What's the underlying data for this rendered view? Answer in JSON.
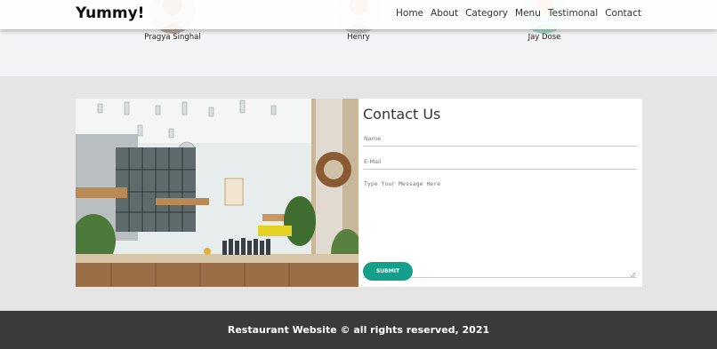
{
  "brand": "Yummy!",
  "nav": [
    "Home",
    "About",
    "Category",
    "Menu",
    "Testimonal",
    "Contact"
  ],
  "testimonials": [
    {
      "name": "Pragya Singhal"
    },
    {
      "name": "Henry"
    },
    {
      "name": "Jay Dose"
    }
  ],
  "contact": {
    "title": "Contact Us",
    "name_placeholder": "Name",
    "email_placeholder": "E-Mail",
    "message_placeholder": "Type Your Message Here",
    "submit_label": "SUBMIT"
  },
  "footer": {
    "text": "Restaurant Website © all rights reserved, 2021"
  },
  "colors": {
    "accent": "#149f8b",
    "footer_bg": "#3a3a3a",
    "section_bg": "#e5e5e5"
  }
}
